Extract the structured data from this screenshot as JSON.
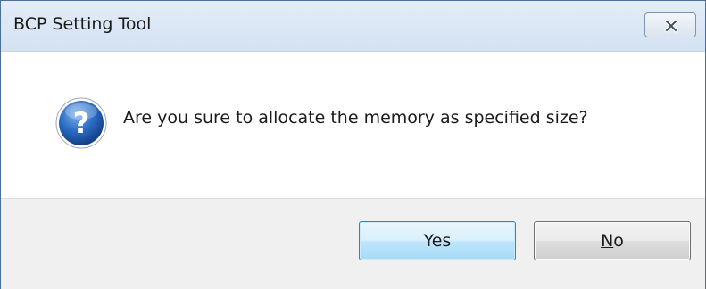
{
  "window": {
    "title": "BCP Setting Tool",
    "close_icon": "close-icon"
  },
  "message": {
    "icon": "question-icon",
    "text": "Are you sure to allocate the memory as specified size?"
  },
  "buttons": {
    "yes_label": "Yes",
    "no_first": "N",
    "no_rest": "o"
  },
  "colors": {
    "title_bar": "#dbe6f4",
    "yes_border": "#3c7fb1",
    "icon_blue": "#1f5fb0",
    "footer_bg": "#f0f0f0"
  }
}
